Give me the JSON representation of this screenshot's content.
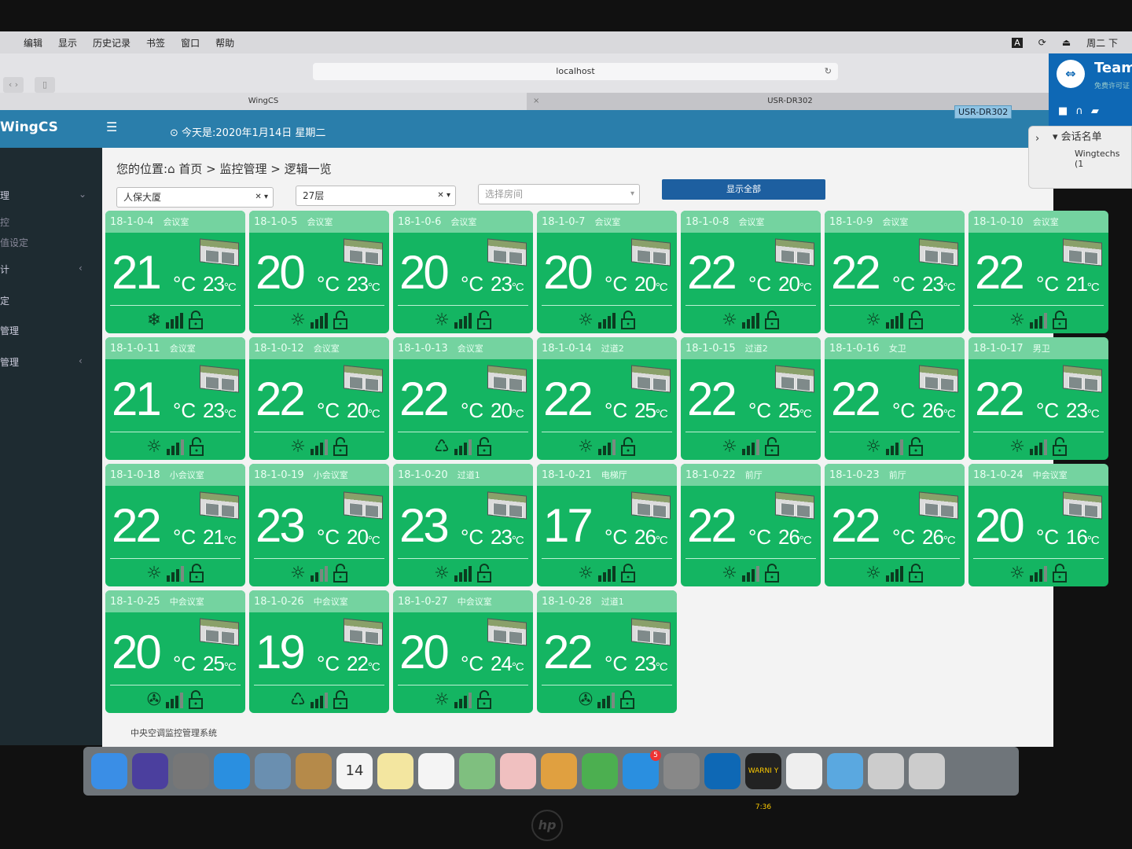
{
  "menubar": {
    "items": [
      "编辑",
      "显示",
      "历史记录",
      "书签",
      "窗口",
      "帮助"
    ],
    "input_source": "A",
    "clock": "周二 下"
  },
  "browser": {
    "url": "localhost",
    "tabs": [
      "WingCS",
      "USR-DR302"
    ],
    "tooltip": "USR-DR302"
  },
  "app": {
    "logo": "WingCS",
    "today": "⊙ 今天是:2020年1月14日 星期二"
  },
  "sidebar": {
    "items": [
      {
        "label": "理",
        "caret": "⌄"
      },
      {
        "label": "控"
      },
      {
        "label": "值设定"
      },
      {
        "label": "计",
        "caret": "‹"
      },
      {
        "label": "定"
      },
      {
        "label": "管理"
      },
      {
        "label": "管理",
        "caret": "‹"
      }
    ]
  },
  "teamviewer": {
    "title": "Team",
    "subtitle": "免费许可证",
    "session_header": "▾ 会话名单",
    "session_item": "Wingtechs (1"
  },
  "breadcrumb": {
    "prefix": "您的位置:",
    "items": [
      "首页",
      "监控管理",
      "逻辑一览"
    ]
  },
  "filters": {
    "building": "人保大厦",
    "floor": "27层",
    "room_placeholder": "选择房间",
    "show_all": "显示全部"
  },
  "colors": {
    "tile_body": "#14b562",
    "tile_header": "#74d3a0",
    "header": "#2a7eab",
    "sidebar": "#1e2b31"
  },
  "units": [
    {
      "id": "18-1-0-4",
      "name": "会议室",
      "temp": 21,
      "set": 23,
      "mode": "cool",
      "fan": 3,
      "lock": "unlocked"
    },
    {
      "id": "18-1-0-5",
      "name": "会议室",
      "temp": 20,
      "set": 23,
      "mode": "heat",
      "fan": 3,
      "lock": "unlocked"
    },
    {
      "id": "18-1-0-6",
      "name": "会议室",
      "temp": 20,
      "set": 23,
      "mode": "heat",
      "fan": 3,
      "lock": "unlocked"
    },
    {
      "id": "18-1-0-7",
      "name": "会议室",
      "temp": 20,
      "set": 20,
      "mode": "heat",
      "fan": 3,
      "lock": "unlocked"
    },
    {
      "id": "18-1-0-8",
      "name": "会议室",
      "temp": 22,
      "set": 20,
      "mode": "heat",
      "fan": 3,
      "lock": "unlocked"
    },
    {
      "id": "18-1-0-9",
      "name": "会议室",
      "temp": 22,
      "set": 23,
      "mode": "heat",
      "fan": 3,
      "lock": "unlocked"
    },
    {
      "id": "18-1-0-10",
      "name": "会议室",
      "temp": 22,
      "set": 21,
      "mode": "heat",
      "fan": 2,
      "lock": "unlocked"
    },
    {
      "id": "18-1-0-11",
      "name": "会议室",
      "temp": 21,
      "set": 23,
      "mode": "heat",
      "fan": 2,
      "lock": "unlocked"
    },
    {
      "id": "18-1-0-12",
      "name": "会议室",
      "temp": 22,
      "set": 20,
      "mode": "heat",
      "fan": 2,
      "lock": "unlocked"
    },
    {
      "id": "18-1-0-13",
      "name": "会议室",
      "temp": 22,
      "set": 20,
      "mode": "recycle",
      "fan": 2,
      "lock": "unlocked"
    },
    {
      "id": "18-1-0-14",
      "name": "过道2",
      "temp": 22,
      "set": 25,
      "mode": "heat",
      "fan": 2,
      "lock": "unlocked"
    },
    {
      "id": "18-1-0-15",
      "name": "过道2",
      "temp": 22,
      "set": 25,
      "mode": "heat",
      "fan": 2,
      "lock": "unlocked"
    },
    {
      "id": "18-1-0-16",
      "name": "女卫",
      "temp": 22,
      "set": 26,
      "mode": "heat",
      "fan": 2,
      "lock": "unlocked"
    },
    {
      "id": "18-1-0-17",
      "name": "男卫",
      "temp": 22,
      "set": 23,
      "mode": "heat",
      "fan": 2,
      "lock": "unlocked"
    },
    {
      "id": "18-1-0-18",
      "name": "小会议室",
      "temp": 22,
      "set": 21,
      "mode": "heat",
      "fan": 2,
      "lock": "unlocked"
    },
    {
      "id": "18-1-0-19",
      "name": "小会议室",
      "temp": 23,
      "set": 20,
      "mode": "heat",
      "fan": 1,
      "lock": "unlocked"
    },
    {
      "id": "18-1-0-20",
      "name": "过道1",
      "temp": 23,
      "set": 23,
      "mode": "heat",
      "fan": 3,
      "lock": "unlocked"
    },
    {
      "id": "18-1-0-21",
      "name": "电梯厅",
      "temp": 17,
      "set": 26,
      "mode": "heat",
      "fan": 3,
      "lock": "unlocked"
    },
    {
      "id": "18-1-0-22",
      "name": "前厅",
      "temp": 22,
      "set": 26,
      "mode": "heat",
      "fan": 2,
      "lock": "unlocked"
    },
    {
      "id": "18-1-0-23",
      "name": "前厅",
      "temp": 22,
      "set": 26,
      "mode": "heat",
      "fan": 3,
      "lock": "unlocked"
    },
    {
      "id": "18-1-0-24",
      "name": "中会议室",
      "temp": 20,
      "set": 16,
      "mode": "heat",
      "fan": 2,
      "lock": "unlocked"
    },
    {
      "id": "18-1-0-25",
      "name": "中会议室",
      "temp": 20,
      "set": 25,
      "mode": "fan",
      "fan": 2,
      "lock": "unlocked"
    },
    {
      "id": "18-1-0-26",
      "name": "中会议室",
      "temp": 19,
      "set": 22,
      "mode": "recycle",
      "fan": 2,
      "lock": "unlocked"
    },
    {
      "id": "18-1-0-27",
      "name": "中会议室",
      "temp": 20,
      "set": 24,
      "mode": "heat",
      "fan": 2,
      "lock": "unlocked"
    },
    {
      "id": "18-1-0-28",
      "name": "过道1",
      "temp": 22,
      "set": 23,
      "mode": "fan",
      "fan": 2,
      "lock": "unlocked"
    }
  ],
  "unit_symbol": "°C",
  "footer": "中央空调监控管理系统",
  "dock": [
    {
      "name": "finder",
      "color": "#3a8ee6"
    },
    {
      "name": "siri",
      "color": "#4b3f9e"
    },
    {
      "name": "launchpad",
      "color": "#777"
    },
    {
      "name": "safari",
      "color": "#2a8fe0"
    },
    {
      "name": "preview",
      "color": "#6a8fb0"
    },
    {
      "name": "notebook",
      "color": "#b58a4a"
    },
    {
      "name": "calendar",
      "color": "#f4f4f4",
      "text": "14"
    },
    {
      "name": "notes",
      "color": "#f3e6a0"
    },
    {
      "name": "reminders",
      "color": "#f4f4f4"
    },
    {
      "name": "maps",
      "color": "#7fbf7f"
    },
    {
      "name": "photos",
      "color": "#f0c0c0"
    },
    {
      "name": "keynote",
      "color": "#e0a040"
    },
    {
      "name": "numbers",
      "color": "#4caf50"
    },
    {
      "name": "app-store",
      "color": "#2a8fe0",
      "badge": "5"
    },
    {
      "name": "system-preferences",
      "color": "#888"
    },
    {
      "name": "teamviewer",
      "color": "#0e68b5"
    },
    {
      "name": "console",
      "color": "#222",
      "text": "WARNI Y 7:36"
    },
    {
      "name": "textedit",
      "color": "#eee"
    },
    {
      "name": "folder",
      "color": "#5aa8e0"
    },
    {
      "name": "screenshot",
      "color": "#ccc"
    },
    {
      "name": "trash",
      "color": "#ccc"
    }
  ]
}
